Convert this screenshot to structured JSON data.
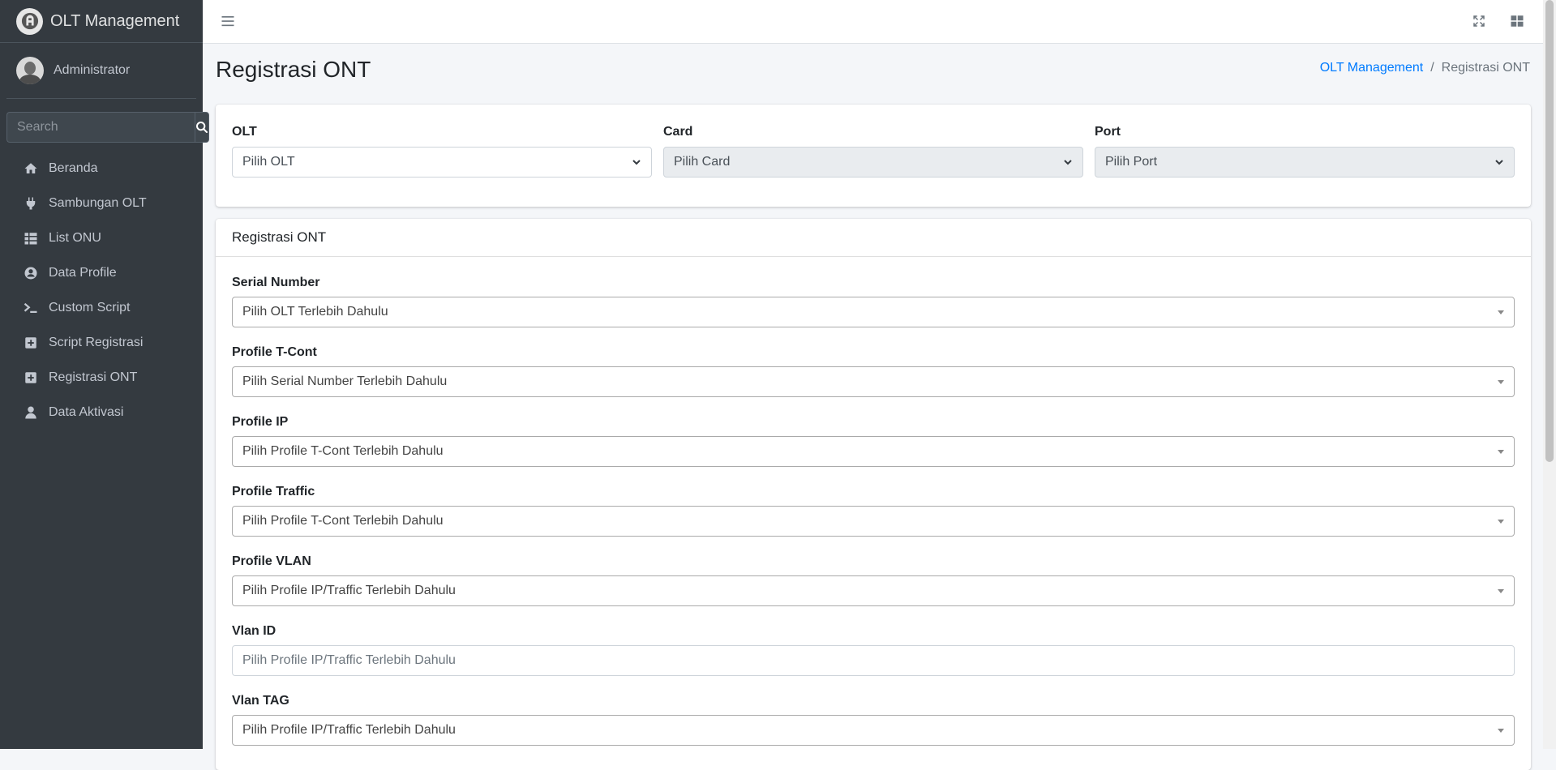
{
  "brand": {
    "title": "OLT Management"
  },
  "user": {
    "name": "Administrator"
  },
  "search": {
    "placeholder": "Search"
  },
  "nav": [
    {
      "label": "Beranda",
      "icon": "home-icon"
    },
    {
      "label": "Sambungan OLT",
      "icon": "plug-icon"
    },
    {
      "label": "List ONU",
      "icon": "list-icon"
    },
    {
      "label": "Data Profile",
      "icon": "user-circle-icon"
    },
    {
      "label": "Custom Script",
      "icon": "terminal-icon"
    },
    {
      "label": "Script Registrasi",
      "icon": "plus-square-icon"
    },
    {
      "label": "Registrasi ONT",
      "icon": "plus-square-icon"
    },
    {
      "label": "Data Aktivasi",
      "icon": "user-icon"
    }
  ],
  "page": {
    "title": "Registrasi ONT"
  },
  "breadcrumb": {
    "home": "OLT Management",
    "separator": "/",
    "current": "Registrasi ONT"
  },
  "filters": {
    "olt": {
      "label": "OLT",
      "value": "Pilih OLT"
    },
    "card": {
      "label": "Card",
      "value": "Pilih Card"
    },
    "port": {
      "label": "Port",
      "value": "Pilih Port"
    }
  },
  "form": {
    "header": "Registrasi ONT",
    "fields": [
      {
        "label": "Serial Number",
        "value": "Pilih OLT Terlebih Dahulu"
      },
      {
        "label": "Profile T-Cont",
        "value": "Pilih Serial Number Terlebih Dahulu"
      },
      {
        "label": "Profile IP",
        "value": "Pilih Profile T-Cont Terlebih Dahulu"
      },
      {
        "label": "Profile Traffic",
        "value": "Pilih Profile T-Cont Terlebih Dahulu"
      },
      {
        "label": "Profile VLAN",
        "value": "Pilih Profile IP/Traffic Terlebih Dahulu"
      },
      {
        "label": "Vlan ID",
        "placeholder": "Pilih Profile IP/Traffic Terlebih Dahulu"
      },
      {
        "label": "Vlan TAG",
        "value": "Pilih Profile IP/Traffic Terlebih Dahulu"
      }
    ]
  }
}
